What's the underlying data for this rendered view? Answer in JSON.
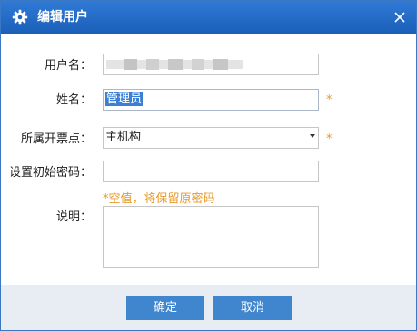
{
  "dialog": {
    "title": "编辑用户",
    "icon": "gear-icon",
    "close_icon": "close-icon"
  },
  "form": {
    "username_label": "用户名：",
    "name_label": "姓名：",
    "name_value": "管理员",
    "branch_label": "所属开票点：",
    "branch_value": "主机构",
    "password_label": "设置初始密码：",
    "password_value": "",
    "password_hint": "*空值，将保留原密码",
    "note_label": "说明：",
    "note_value": "",
    "required_mark": "*"
  },
  "footer": {
    "ok_label": "确定",
    "cancel_label": "取消"
  },
  "colors": {
    "titlebar": "#1f66c0",
    "accent_button": "#3f86cf",
    "hint": "#e59a2a"
  }
}
